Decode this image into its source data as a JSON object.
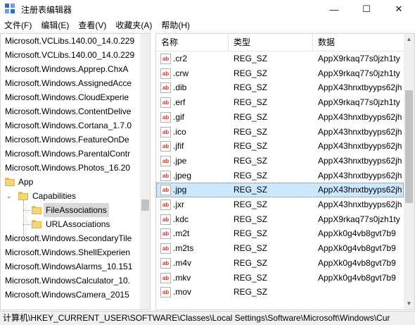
{
  "window": {
    "title": "注册表编辑器",
    "controls": {
      "minimize": "—",
      "maximize": "☐",
      "close": "✕"
    }
  },
  "menu": [
    "文件(F)",
    "编辑(E)",
    "查看(V)",
    "收藏夹(A)",
    "帮助(H)"
  ],
  "tree": {
    "items": [
      "Microsoft.VCLibs.140.00_14.0.229",
      "Microsoft.VCLibs.140.00_14.0.229",
      "Microsoft.Windows.Apprep.ChxA",
      "Microsoft.Windows.AssignedAcce",
      "Microsoft.Windows.CloudExperie",
      "Microsoft.Windows.ContentDelive",
      "Microsoft.Windows.Cortana_1.7.0",
      "Microsoft.Windows.FeatureOnDe",
      "Microsoft.Windows.ParentalContr",
      "Microsoft.Windows.Photos_16.20",
      "App",
      "Capabilities",
      "FileAssociations",
      "URLAssociations",
      "Microsoft.Windows.SecondaryTile",
      "Microsoft.Windows.ShellExperien",
      "Microsoft.WindowsAlarms_10.151",
      "Microsoft.WindowsCalculator_10.",
      "Microsoft.WindowsCamera_2015"
    ],
    "selected": "FileAssociations"
  },
  "columns": {
    "name": "名称",
    "type": "类型",
    "data": "数据"
  },
  "values": [
    {
      "name": ".cr2",
      "type": "REG_SZ",
      "data": "AppX9rkaq77s0jzh1ty"
    },
    {
      "name": ".crw",
      "type": "REG_SZ",
      "data": "AppX9rkaq77s0jzh1ty"
    },
    {
      "name": ".dib",
      "type": "REG_SZ",
      "data": "AppX43hnxtbyyps62jh"
    },
    {
      "name": ".erf",
      "type": "REG_SZ",
      "data": "AppX9rkaq77s0jzh1ty"
    },
    {
      "name": ".gif",
      "type": "REG_SZ",
      "data": "AppX43hnxtbyyps62jh"
    },
    {
      "name": ".ico",
      "type": "REG_SZ",
      "data": "AppX43hnxtbyyps62jh"
    },
    {
      "name": ".jfif",
      "type": "REG_SZ",
      "data": "AppX43hnxtbyyps62jh"
    },
    {
      "name": ".jpe",
      "type": "REG_SZ",
      "data": "AppX43hnxtbyyps62jh"
    },
    {
      "name": ".jpeg",
      "type": "REG_SZ",
      "data": "AppX43hnxtbyyps62jh"
    },
    {
      "name": ".jpg",
      "type": "REG_SZ",
      "data": "AppX43hnxtbyyps62jh"
    },
    {
      "name": ".jxr",
      "type": "REG_SZ",
      "data": "AppX43hnxtbyyps62jh"
    },
    {
      "name": ".kdc",
      "type": "REG_SZ",
      "data": "AppX9rkaq77s0jzh1ty"
    },
    {
      "name": ".m2t",
      "type": "REG_SZ",
      "data": "AppXk0g4vb8gvt7b9"
    },
    {
      "name": ".m2ts",
      "type": "REG_SZ",
      "data": "AppXk0g4vb8gvt7b9"
    },
    {
      "name": ".m4v",
      "type": "REG_SZ",
      "data": "AppXk0g4vb8gvt7b9"
    },
    {
      "name": ".mkv",
      "type": "REG_SZ",
      "data": "AppXk0g4vb8gvt7b9"
    },
    {
      "name": ".mov",
      "type": "REG_SZ",
      "data": ""
    }
  ],
  "selected_value": ".jpg",
  "icon_label": "ab",
  "statusbar": {
    "path": "计算机\\HKEY_CURRENT_USER\\SOFTWARE\\Classes\\Local Settings\\Software\\Microsoft\\Windows\\Cur"
  },
  "colors": {
    "selection": "#cce8ff",
    "tree_selection": "#d9d9d9",
    "folder": "#f3d57a"
  }
}
